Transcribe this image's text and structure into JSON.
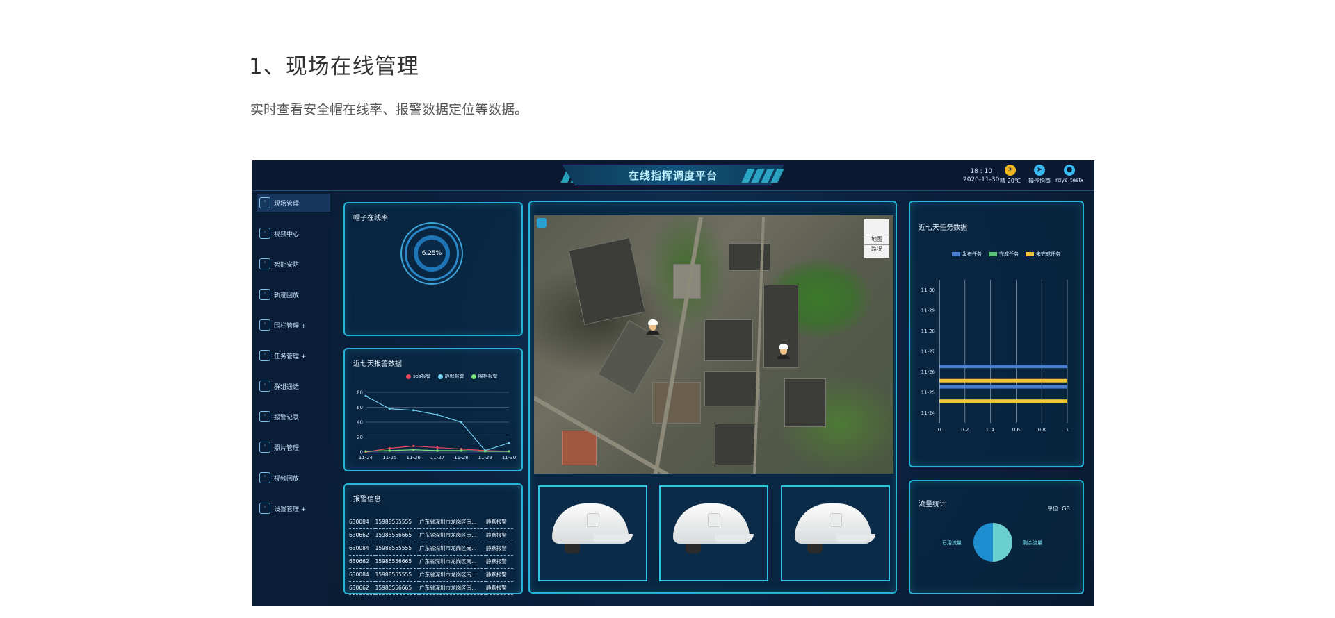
{
  "heading": "1、现场在线管理",
  "description": "实时查看安全帽在线率、报警数据定位等数据。",
  "app": {
    "title": "在线指挥调度平台",
    "time": "18 : 10",
    "date": "2020-11-30",
    "weather": "晴 20℃",
    "guide": "操作指南",
    "user": "rdys_test"
  },
  "sidebar": [
    {
      "label": "现场管理",
      "icon": "location-icon",
      "active": true
    },
    {
      "label": "视频中心",
      "icon": "video-icon"
    },
    {
      "label": "智能安防",
      "icon": "camera-icon"
    },
    {
      "label": "轨迹回放",
      "icon": "history-icon"
    },
    {
      "label": "围栏管理 +",
      "icon": "fence-icon"
    },
    {
      "label": "任务管理 +",
      "icon": "task-icon"
    },
    {
      "label": "群组通话",
      "icon": "group-call-icon"
    },
    {
      "label": "报警记录",
      "icon": "alarm-icon"
    },
    {
      "label": "照片管理",
      "icon": "photo-icon"
    },
    {
      "label": "视频回放",
      "icon": "play-icon"
    },
    {
      "label": "设置管理 +",
      "icon": "settings-icon"
    }
  ],
  "online_panel": {
    "title": "帽子在线率",
    "value": "6.25%"
  },
  "alarm_chart": {
    "title": "近七天报警数据",
    "legend": [
      "sos报警",
      "静默报警",
      "围栏报警"
    ],
    "colors": [
      "#e84a5f",
      "#6fd0f0",
      "#7be37b"
    ]
  },
  "alarm_table": {
    "title": "报警信息",
    "rows": [
      [
        "630084",
        "15988555555",
        "广东省深圳市龙岗区南...",
        "静默报警"
      ],
      [
        "630662",
        "15985556665",
        "广东省深圳市龙岗区南...",
        "静默报警"
      ],
      [
        "630084",
        "15988555555",
        "广东省深圳市龙岗区南...",
        "静默报警"
      ],
      [
        "630662",
        "15985556665",
        "广东省深圳市龙岗区南...",
        "静默报警"
      ],
      [
        "630084",
        "15988555555",
        "广东省深圳市龙岗区南...",
        "静默报警"
      ],
      [
        "630662",
        "15985556665",
        "广东省深圳市龙岗区南...",
        "静默报警"
      ]
    ]
  },
  "map": {
    "layers": [
      "地图",
      "路况"
    ]
  },
  "task_panel": {
    "title": "近七天任务数据",
    "legend": [
      "发布任务",
      "完成任务",
      "未完成任务"
    ],
    "colors": [
      "#4a7fd0",
      "#5cc47a",
      "#f1c23a"
    ]
  },
  "traffic_panel": {
    "title": "流量统计",
    "unit": "单位: GB",
    "used_label": "已用流量",
    "remain_label": "剩余流量"
  },
  "chart_data": [
    {
      "type": "line",
      "title": "近七天报警数据",
      "categories": [
        "11-24",
        "11-25",
        "11-26",
        "11-27",
        "11-28",
        "11-29",
        "11-30"
      ],
      "y_ticks": [
        "0",
        "20",
        "40",
        "60",
        "80"
      ],
      "ylim": [
        0,
        80
      ],
      "series": [
        {
          "name": "sos报警",
          "values": [
            0,
            5,
            8,
            6,
            4,
            2,
            1
          ]
        },
        {
          "name": "静默报警",
          "values": [
            75,
            58,
            56,
            50,
            40,
            2,
            12
          ]
        },
        {
          "name": "围栏报警",
          "values": [
            1,
            2,
            3,
            2,
            2,
            1,
            1
          ]
        }
      ]
    },
    {
      "type": "bar",
      "title": "近七天任务数据",
      "categories": [
        "11-24",
        "11-25",
        "11-26",
        "11-27",
        "11-28",
        "11-29",
        "11-30"
      ],
      "x_ticks": [
        "0",
        "0.2",
        "0.4",
        "0.6",
        "0.8",
        "1"
      ],
      "xlim": [
        0,
        1
      ],
      "series": [
        {
          "name": "发布任务",
          "values": [
            0,
            1,
            1,
            0,
            0,
            0,
            0
          ]
        },
        {
          "name": "完成任务",
          "values": [
            0,
            0,
            0,
            0,
            0,
            0,
            0
          ]
        },
        {
          "name": "未完成任务",
          "values": [
            0,
            1,
            1,
            0,
            0,
            0,
            0
          ]
        }
      ]
    },
    {
      "type": "pie",
      "title": "流量统计",
      "labels": [
        "已用流量",
        "剩余流量"
      ],
      "values": [
        50,
        50
      ]
    }
  ]
}
